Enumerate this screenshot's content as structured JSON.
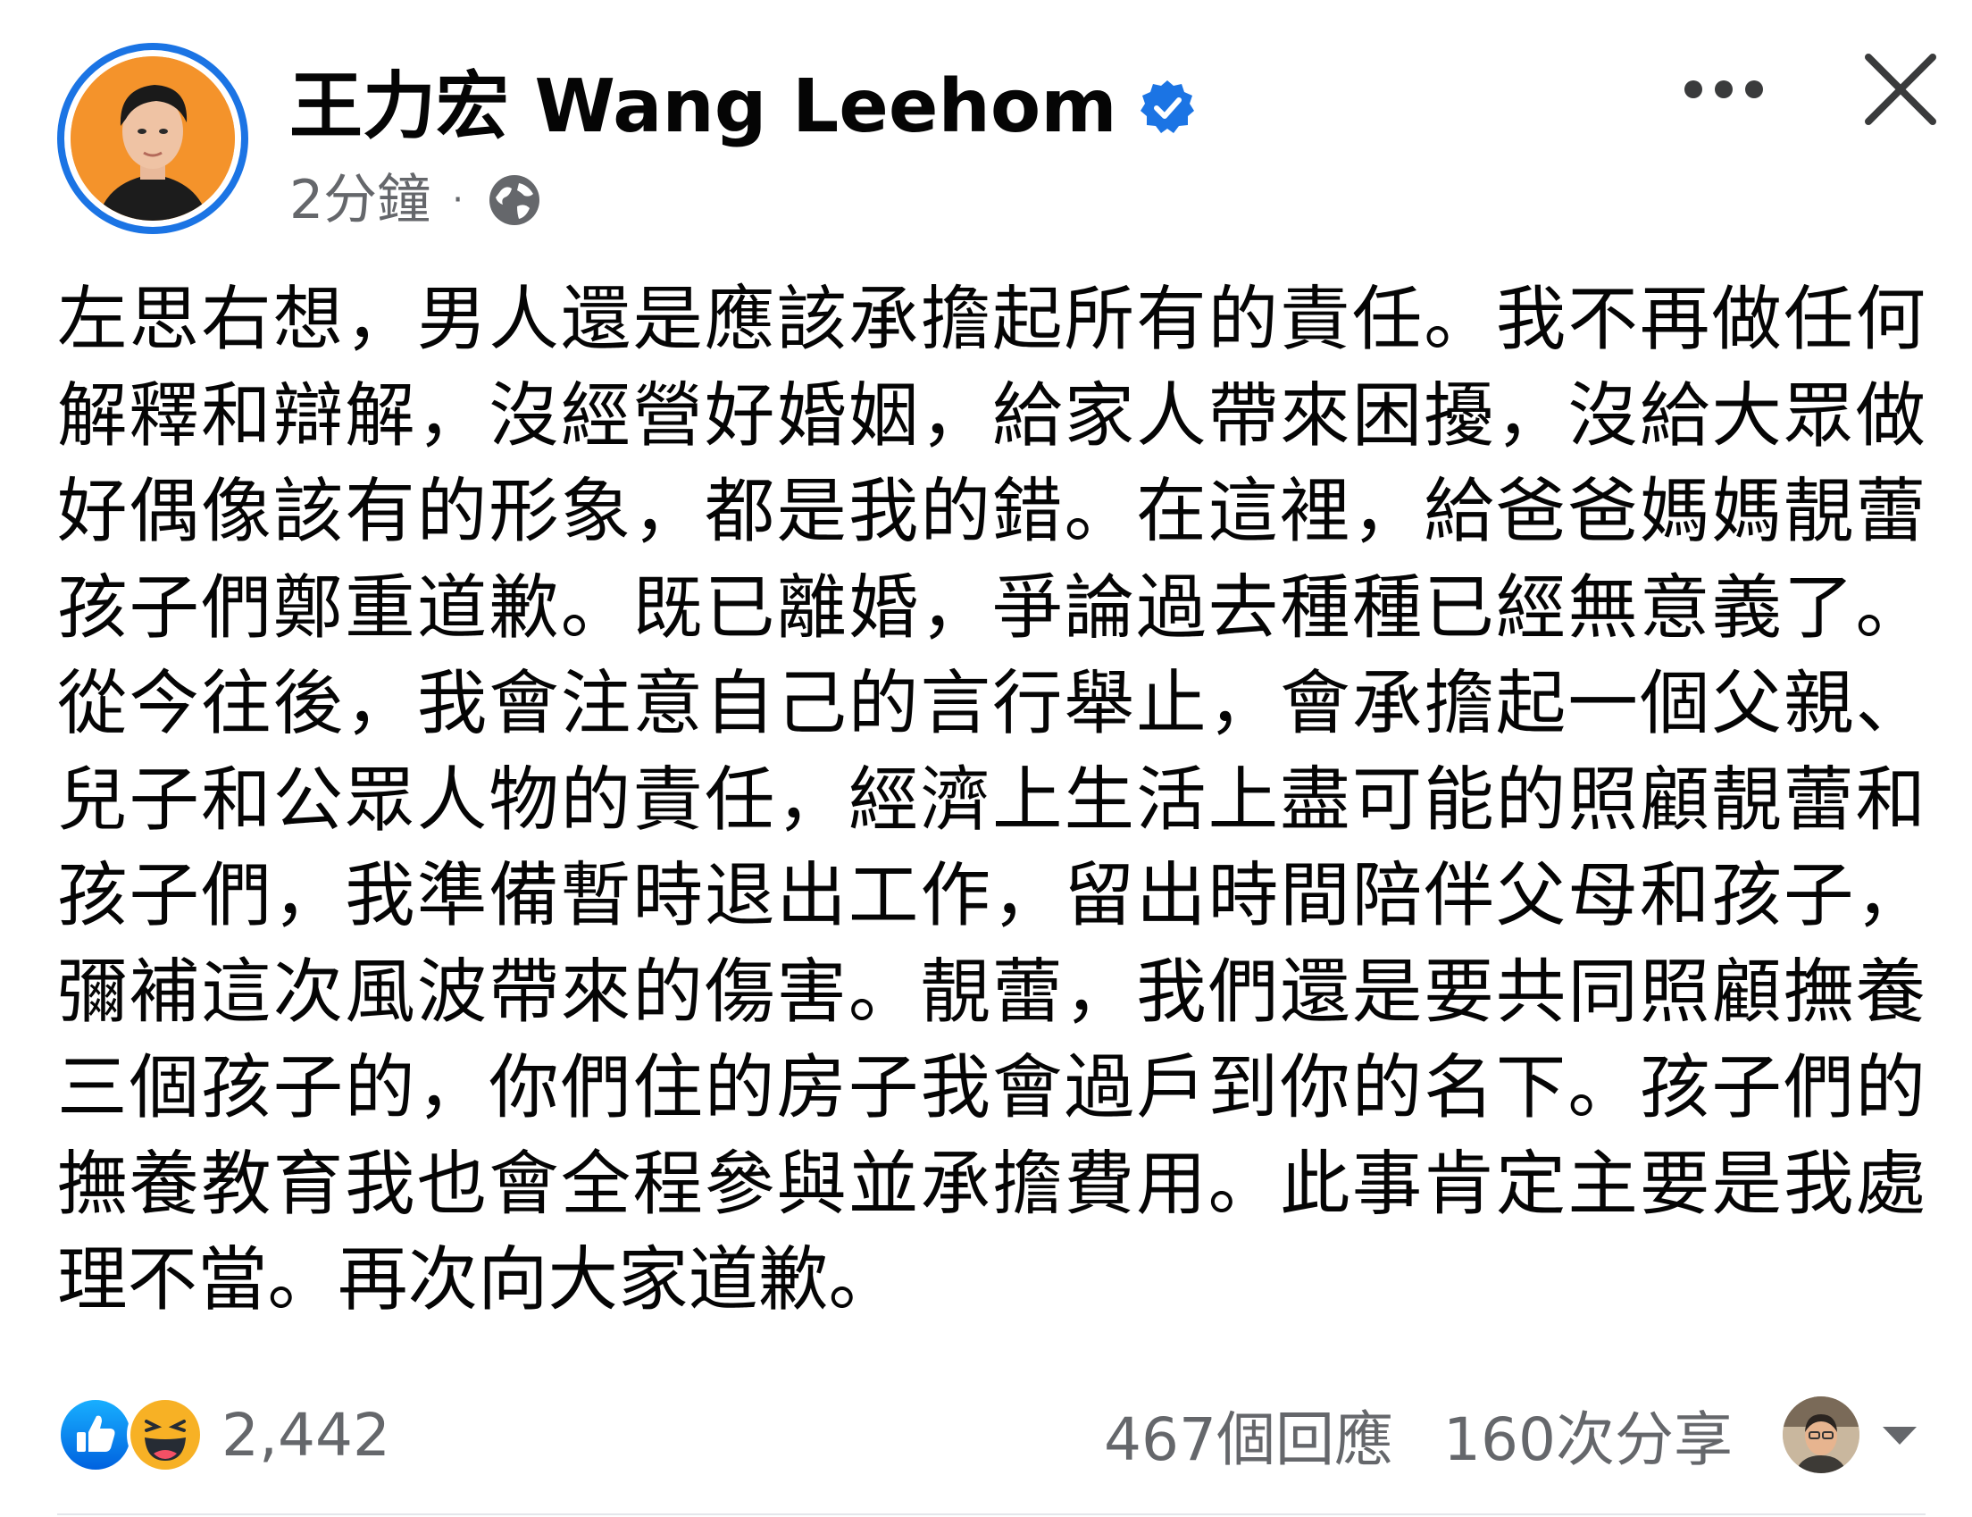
{
  "post": {
    "author": "王力宏 Wang Leehom",
    "timestamp": "2分鐘",
    "separator": "·",
    "privacy_icon": "globe-icon",
    "verified_icon": "verified-badge-icon",
    "body": "左思右想，男人還是應該承擔起所有的責任。我不再做任何解釋和辯解，沒經營好婚姻，給家人帶來困擾，沒給大眾做好偶像該有的形象，都是我的錯。在這裡，給爸爸媽媽靚蕾孩子們鄭重道歉。既已離婚，爭論過去種種已經無意義了。從今往後，我會注意自己的言行舉止，會承擔起一個父親、兒子和公眾人物的責任，經濟上生活上盡可能的照顧靚蕾和孩子們，我準備暫時退出工作，留出時間陪伴父母和孩子，彌補這次風波帶來的傷害。靚蕾，我們還是要共同照顧撫養三個孩子的，你們住的房子我會過戶到你的名下。孩子們的撫養教育我也會全程參與並承擔費用。此事肯定主要是我處理不當。再次向大家道歉。"
  },
  "reactions": {
    "icons": [
      "like-icon",
      "haha-icon"
    ],
    "count": "2,442"
  },
  "stats": {
    "comments": "467個回應",
    "shares": "160次分享"
  },
  "colors": {
    "accent": "#1b74e4",
    "secondary_text": "#65676b",
    "primary_text": "#050505",
    "avatar_bg": "#f4932b",
    "haha_yellow": "#f7b125"
  }
}
